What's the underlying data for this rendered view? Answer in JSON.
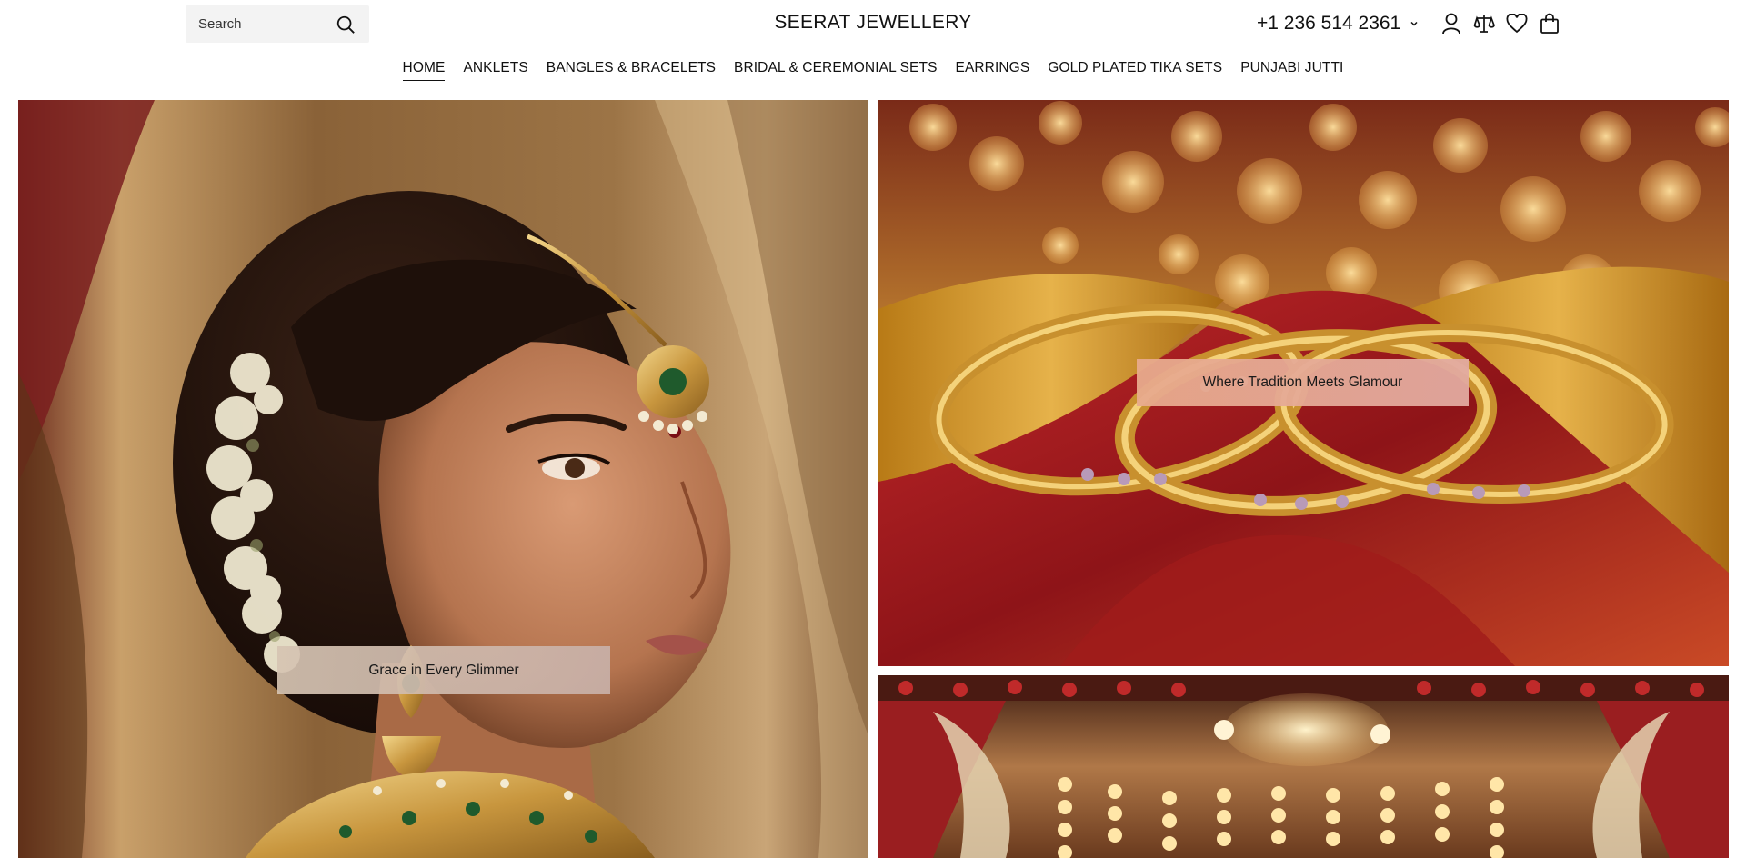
{
  "header": {
    "search_placeholder": "Search",
    "logo": "SEERAT JEWELLERY",
    "phone": "+1 236 514 2361",
    "icons": [
      "user-icon",
      "compare-icon",
      "heart-icon",
      "bag-icon"
    ]
  },
  "nav": {
    "items": [
      {
        "label": "HOME",
        "active": true
      },
      {
        "label": "ANKLETS"
      },
      {
        "label": "BANGLES & BRACELETS"
      },
      {
        "label": "BRIDAL & CEREMONIAL SETS"
      },
      {
        "label": "EARRINGS"
      },
      {
        "label": "GOLD PLATED TIKA SETS"
      },
      {
        "label": "PUNJABI JUTTI"
      }
    ]
  },
  "hero": {
    "left_caption": "Grace in Every Glimmer",
    "right_top_caption": "Where Tradition Meets Glamour"
  },
  "colors": {
    "text": "#111111",
    "search_bg": "#f3f3f3",
    "gold": "#d4a24a",
    "crimson": "#8b1c1c"
  }
}
